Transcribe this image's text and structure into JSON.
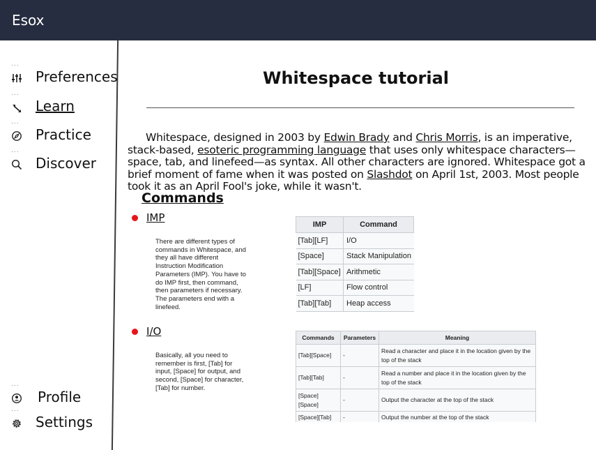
{
  "app": {
    "title": "Esox"
  },
  "sidebar": {
    "items": [
      {
        "label": "Preferences",
        "icon": "sliders-icon",
        "active": false
      },
      {
        "label": "Learn",
        "icon": "learn-icon",
        "active": true
      },
      {
        "label": "Practice",
        "icon": "compass-icon",
        "active": false
      },
      {
        "label": "Discover",
        "icon": "search-icon",
        "active": false
      }
    ],
    "bottom_items": [
      {
        "label": "Profile",
        "icon": "profile-icon"
      },
      {
        "label": "Settings",
        "icon": "gear-icon"
      }
    ]
  },
  "main": {
    "title": "Whitespace tutorial",
    "intro": {
      "t1": "Whitespace, designed in 2003 by ",
      "link1": "Edwin Brady",
      "t2": " and ",
      "link2": "Chris Morris",
      "t3": ", is an imperative, stack-based, ",
      "link3": "esoteric programming language",
      "t4": " that uses only whitespace characters—space, tab, and linefeed—as syntax. All other characters are ignored. Whitespace got a brief moment of fame when it was posted on ",
      "link4": "Slashdot",
      "t5": " on April 1st, 2003. Most people took it as an April Fool's joke, while it wasn't."
    },
    "section_title": "Commands",
    "imp": {
      "title": "IMP",
      "description": "There are different types of commands in Whitespace, and they all have different Instruction Modification Parameters (IMP). You have to do IMP first, then command, then parameters if necessary. The parameters end with a linefeed.",
      "table": {
        "headers": [
          "IMP",
          "Command"
        ],
        "rows": [
          [
            "[Tab][LF]",
            "I/O"
          ],
          [
            "[Space]",
            "Stack Manipulation"
          ],
          [
            "[Tab][Space]",
            "Arithmetic"
          ],
          [
            "[LF]",
            "Flow control"
          ],
          [
            "[Tab][Tab]",
            "Heap access"
          ]
        ]
      }
    },
    "io": {
      "title": "I/O",
      "description": "Basically, all you need to remember is first, [Tab] for input, [Space] for output, and second, [Space] for character, [Tab] for number.",
      "table": {
        "headers": [
          "Commands",
          "Parameters",
          "Meaning"
        ],
        "rows": [
          [
            "[Tab][Space]",
            "-",
            "Read a character and place it in the location given by the top of the stack"
          ],
          [
            "[Tab][Tab]",
            "-",
            "Read a number and place it in the location given by the top of the stack"
          ],
          [
            "[Space] [Space]",
            "-",
            "Output the character at the top of the stack"
          ],
          [
            "[Space][Tab]",
            "-",
            "Output the number at the top of the stack"
          ]
        ]
      }
    }
  },
  "colors": {
    "topbar": "#272d40",
    "bullet": "#e8141b",
    "table_header": "#eaecf0"
  }
}
